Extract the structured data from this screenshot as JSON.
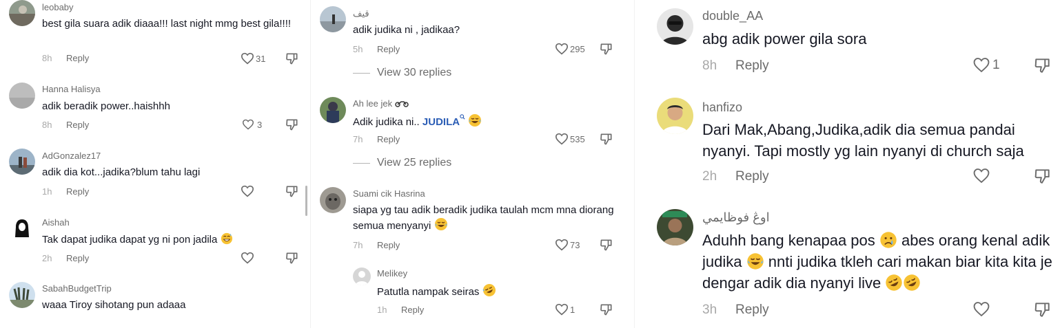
{
  "col1": [
    {
      "username": "leobaby",
      "text": "best gila suara adik diaaa!!! last night mmg best gila!!!!",
      "time": "8h",
      "reply": "Reply",
      "likes": "31"
    },
    {
      "username": "Hanna Halisya",
      "text": "adik beradik power..haishhh",
      "time": "8h",
      "reply": "Reply",
      "likes": "3"
    },
    {
      "username": "AdGonzalez17",
      "text": "adik dia kot...jadika?blum tahu lagi",
      "time": "1h",
      "reply": "Reply",
      "likes": ""
    },
    {
      "username": "Aishah",
      "text": "Tak dapat judika dapat yg ni pon jadila",
      "time": "2h",
      "reply": "Reply",
      "likes": ""
    },
    {
      "username": "SabahBudgetTrip",
      "text": "waaa Tiroy sihotang pun adaaa"
    }
  ],
  "col2": [
    {
      "username": "قيف",
      "text": "adik judika ni , jadikaa?",
      "time": "5h",
      "reply": "Reply",
      "likes": "295",
      "view_replies": "View 30 replies"
    },
    {
      "username": "Ah lee jek",
      "text_before": "Adik judika ni..",
      "highlight": "JUDILA",
      "time": "7h",
      "reply": "Reply",
      "likes": "535",
      "view_replies": "View 25 replies"
    },
    {
      "username": "Suami cik Hasrina",
      "text": "siapa yg tau adik beradik judika taulah mcm mna diorang semua menyanyi",
      "time": "7h",
      "reply": "Reply",
      "likes": "73"
    },
    {
      "username": "Melikey",
      "text": "Patutla nampak seiras",
      "time": "1h",
      "reply": "Reply",
      "likes": "1"
    }
  ],
  "col3": [
    {
      "username": "double_AA",
      "text": "abg adik power gila sora",
      "time": "8h",
      "reply": "Reply",
      "likes": "1"
    },
    {
      "username": "hanfizo",
      "text": "Dari Mak,Abang,Judika,adik dia semua pandai nyanyi. Tapi mostly yg lain nyanyi di church saja",
      "time": "2h",
      "reply": "Reply",
      "likes": ""
    },
    {
      "username": "اوڠ فوظايمي",
      "text_a": "Aduhh bang kenapaa pos",
      "text_b": "abes orang kenal adik judika",
      "text_c": "nnti judika tkleh cari makan biar kita kita je dengar adik dia nyanyi live",
      "time": "3h",
      "reply": "Reply",
      "likes": ""
    }
  ],
  "icons": {
    "like": "heart-outline-icon",
    "dislike": "thumbs-down-icon",
    "search": "search-icon",
    "emoji_grin": "grinning-sweat-emoji",
    "emoji_laugh": "tears-of-joy-emoji",
    "emoji_rofl": "rolling-laughing-emoji",
    "emoji_sad": "sad-tear-emoji",
    "emoji_moto": "motorcycle-emoji"
  },
  "colors": {
    "text": "#161823",
    "username": "#6b6b6b",
    "time": "#a8a8a8",
    "highlight": "#2b5db5"
  }
}
